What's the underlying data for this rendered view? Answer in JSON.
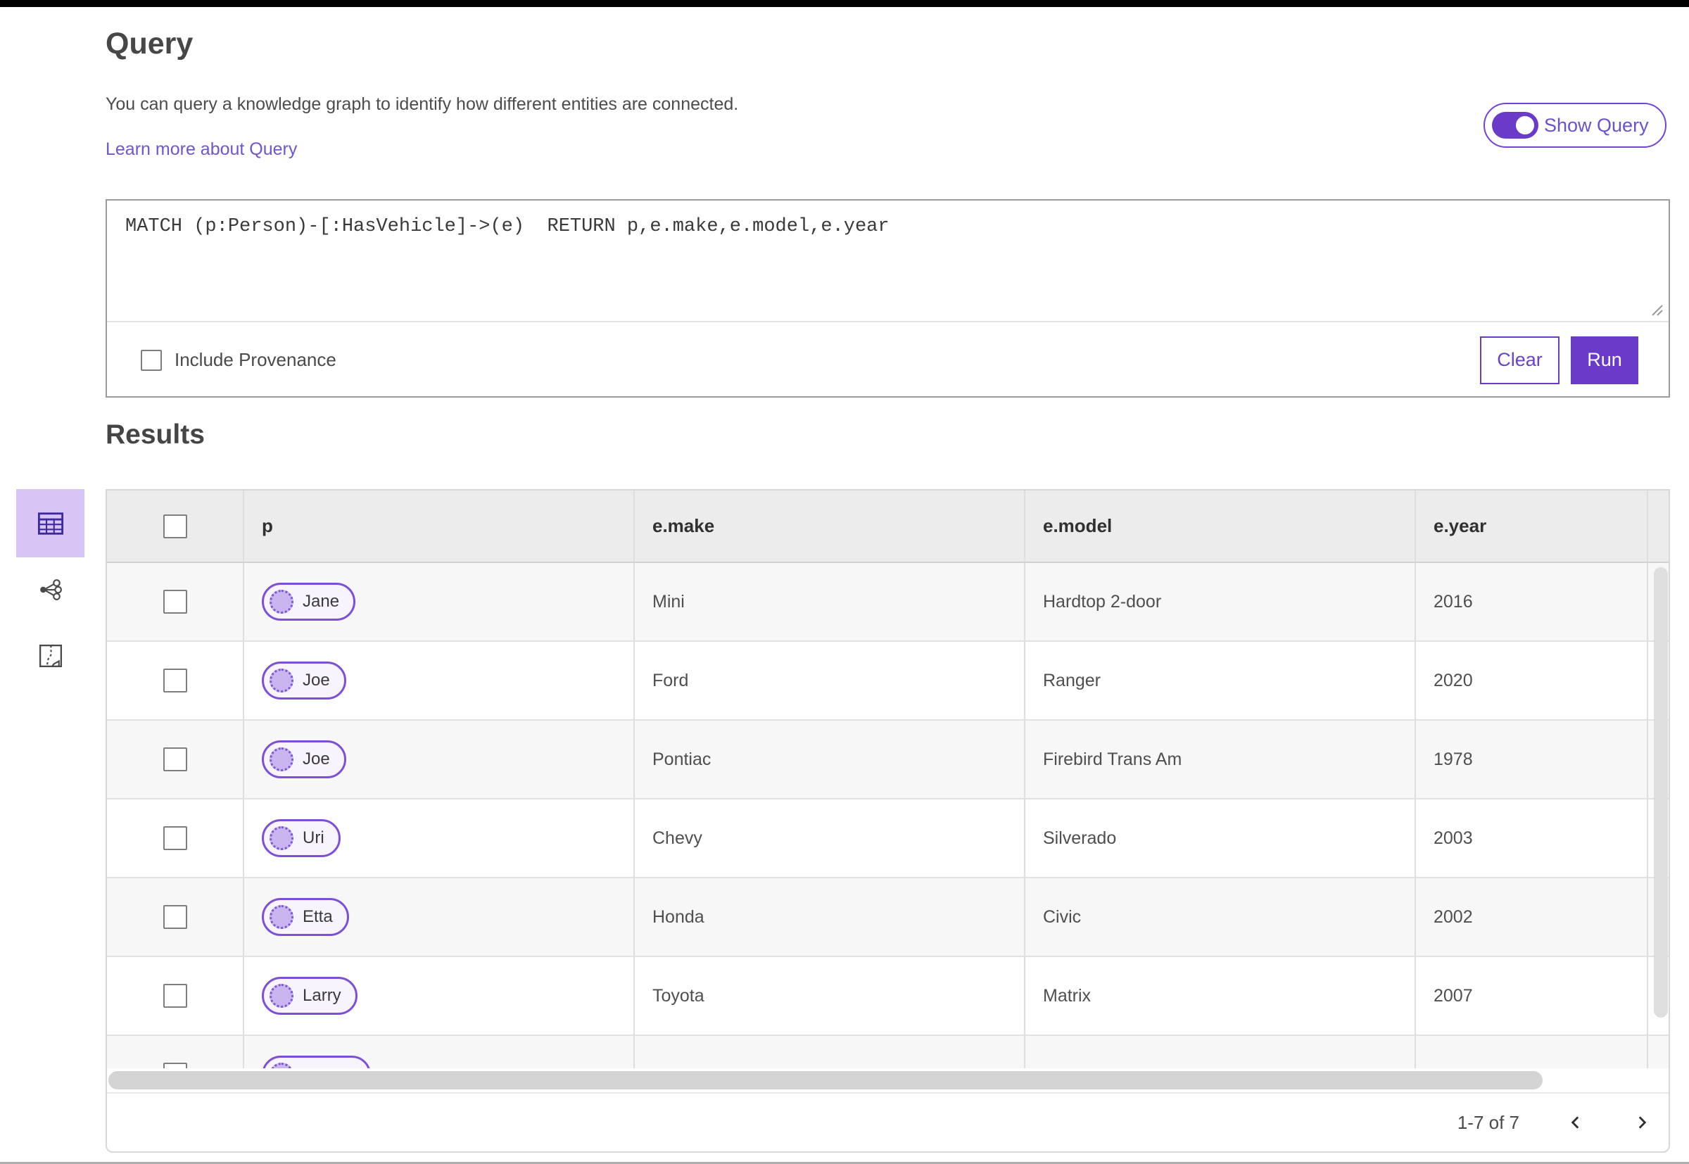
{
  "colors": {
    "accent_purple": "#6a3ac9",
    "accent_border_purple": "#7143d8",
    "selected_view_bg": "#d8c5f5",
    "link_purple": "#7055cf",
    "entity_pill_border": "#7b4fd8",
    "entity_pill_dot": "#cab5f0",
    "table_header_bg": "#ececec",
    "row_alt_bg": "#f7f7f7"
  },
  "query_panel": {
    "title": "Query",
    "description": "You can query a knowledge graph to identify how different entities are connected.",
    "learn_more_label": "Learn more about Query",
    "show_query_label": "Show Query",
    "query_text": "MATCH (p:Person)-[:HasVehicle]->(e)  RETURN p,e.make,e.model,e.year",
    "include_provenance_label": "Include Provenance",
    "clear_label": "Clear",
    "run_label": "Run"
  },
  "results": {
    "title": "Results",
    "views": [
      {
        "icon": "table-view-icon",
        "selected": true
      },
      {
        "icon": "link-chart-view-icon",
        "selected": false
      },
      {
        "icon": "map-view-icon",
        "selected": false
      }
    ],
    "table": {
      "columns": [
        "p",
        "e.make",
        "e.model",
        "e.year"
      ],
      "rows": [
        {
          "p": "Jane",
          "e_make": "Mini",
          "e_model": "Hardtop 2-door",
          "e_year": "2016"
        },
        {
          "p": "Joe",
          "e_make": "Ford",
          "e_model": "Ranger",
          "e_year": "2020"
        },
        {
          "p": "Joe",
          "e_make": "Pontiac",
          "e_model": "Firebird Trans Am",
          "e_year": "1978"
        },
        {
          "p": "Uri",
          "e_make": "Chevy",
          "e_model": "Silverado",
          "e_year": "2003"
        },
        {
          "p": "Etta",
          "e_make": "Honda",
          "e_model": "Civic",
          "e_year": "2002"
        },
        {
          "p": "Larry",
          "e_make": "Toyota",
          "e_model": "Matrix",
          "e_year": "2007"
        }
      ],
      "partial_row_visible": true
    },
    "pagination": {
      "range_label": "1-7 of 7"
    }
  }
}
